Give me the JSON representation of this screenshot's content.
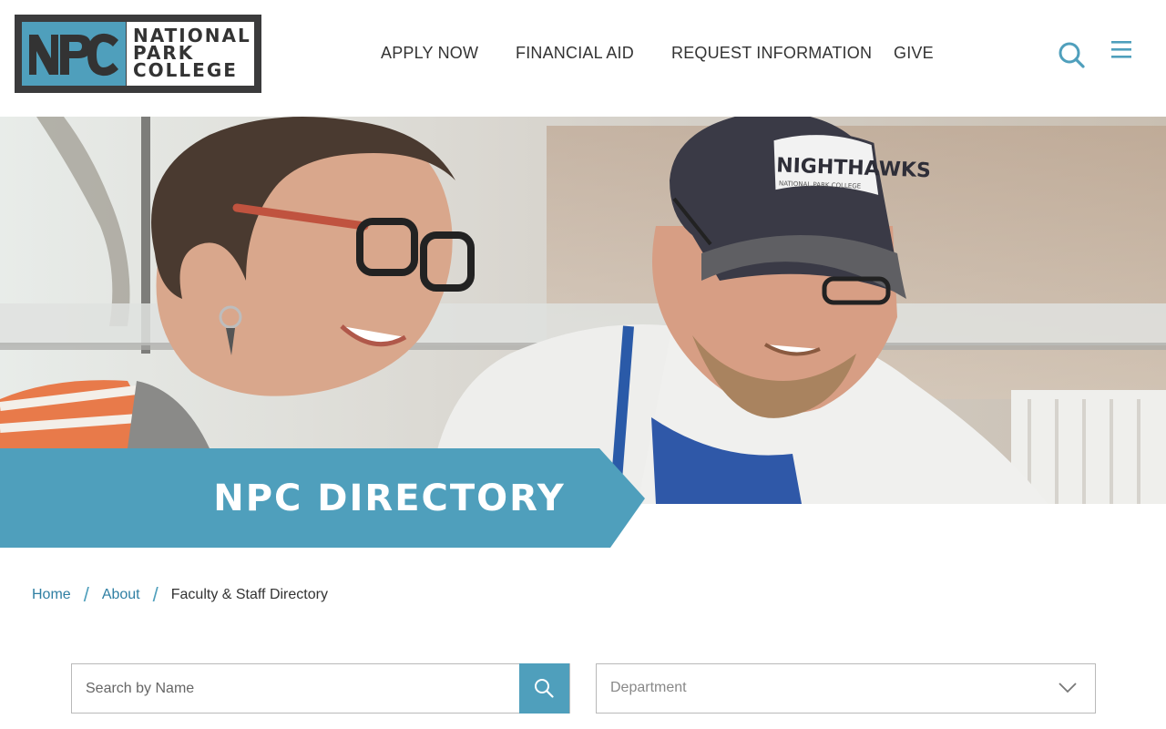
{
  "brand": {
    "logo_mark": "NPC",
    "logo_lines": [
      "NATIONAL",
      "PARK",
      "COLLEGE"
    ],
    "accent_color": "#4f9fbc",
    "dark_color": "#3b3b3c"
  },
  "nav": {
    "items": [
      {
        "label": "APPLY NOW"
      },
      {
        "label": "FINANCIAL AID"
      },
      {
        "label": "REQUEST INFORMATION"
      },
      {
        "label": "GIVE"
      }
    ],
    "search_icon": "search-icon",
    "menu_icon": "hamburger-menu-icon"
  },
  "hero": {
    "cap_text": "NIGHTHAWKS",
    "cap_subtext": "NATIONAL PARK COLLEGE",
    "banner_title": "NPC DIRECTORY"
  },
  "breadcrumb": {
    "items": [
      {
        "label": "Home"
      },
      {
        "label": "About"
      }
    ],
    "separator": "/",
    "current": "Faculty & Staff Directory"
  },
  "filters": {
    "search_placeholder": "Search by Name",
    "department_label": "Department",
    "search_button_icon": "search-icon",
    "dropdown_icon": "chevron-down-icon"
  }
}
